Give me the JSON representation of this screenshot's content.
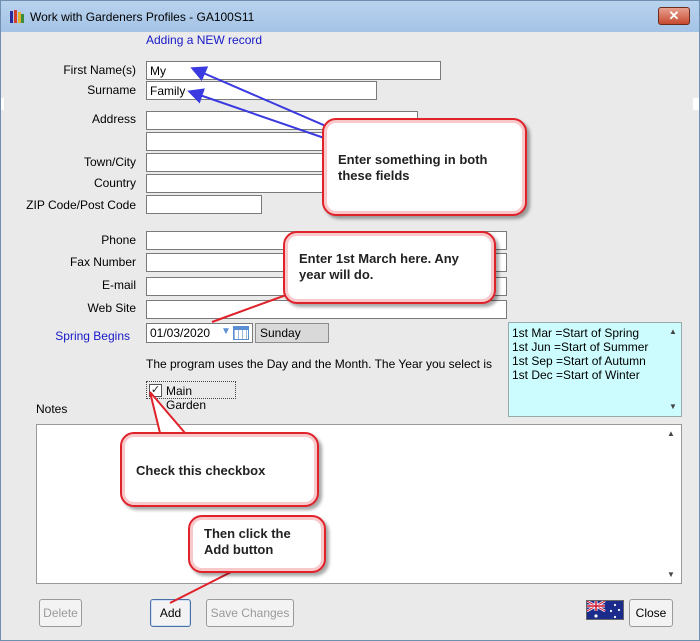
{
  "window": {
    "title": "Work with Gardeners Profiles - GA100S11",
    "close_glyph": "✕"
  },
  "mode_text": "Adding a NEW record",
  "form": {
    "first_name": {
      "label": "First Name(s)",
      "value": "My"
    },
    "surname": {
      "label": "Surname",
      "value": "Family"
    },
    "address": {
      "label": "Address",
      "value": "",
      "value2": ""
    },
    "town_city": {
      "label": "Town/City",
      "value": ""
    },
    "country": {
      "label": "Country",
      "value": ""
    },
    "zip": {
      "label": "ZIP Code/Post Code",
      "value": ""
    },
    "phone": {
      "label": "Phone",
      "value": ""
    },
    "fax": {
      "label": "Fax Number",
      "value": ""
    },
    "email": {
      "label": "E-mail",
      "value": ""
    },
    "website": {
      "label": "Web Site",
      "value": ""
    },
    "spring": {
      "label": "Spring Begins",
      "date": "01/03/2020",
      "day": "Sunday"
    },
    "program_note": "The program uses the Day and the Month. The Year you select is",
    "seasons": [
      "1st Mar =Start of Spring",
      "1st Jun =Start of Summer",
      "1st Sep =Start of Autumn",
      "1st Dec =Start of Winter"
    ],
    "main_garden": {
      "label": "Main Garden",
      "checked": true,
      "mark": "✓"
    },
    "notes": {
      "label": "Notes",
      "value": ""
    }
  },
  "buttons": {
    "delete": "Delete",
    "add": "Add",
    "save_changes": "Save Changes",
    "close": "Close"
  },
  "callouts": {
    "name_fields": "Enter something in both these fields",
    "spring": "Enter 1st March here. Any year will do.",
    "checkbox": "Check this checkbox",
    "add": "Then click the Add button"
  },
  "colors": {
    "accent_blue": "#1717c8",
    "callout_border": "#e0222a",
    "season_bg": "#ccfcfd"
  }
}
